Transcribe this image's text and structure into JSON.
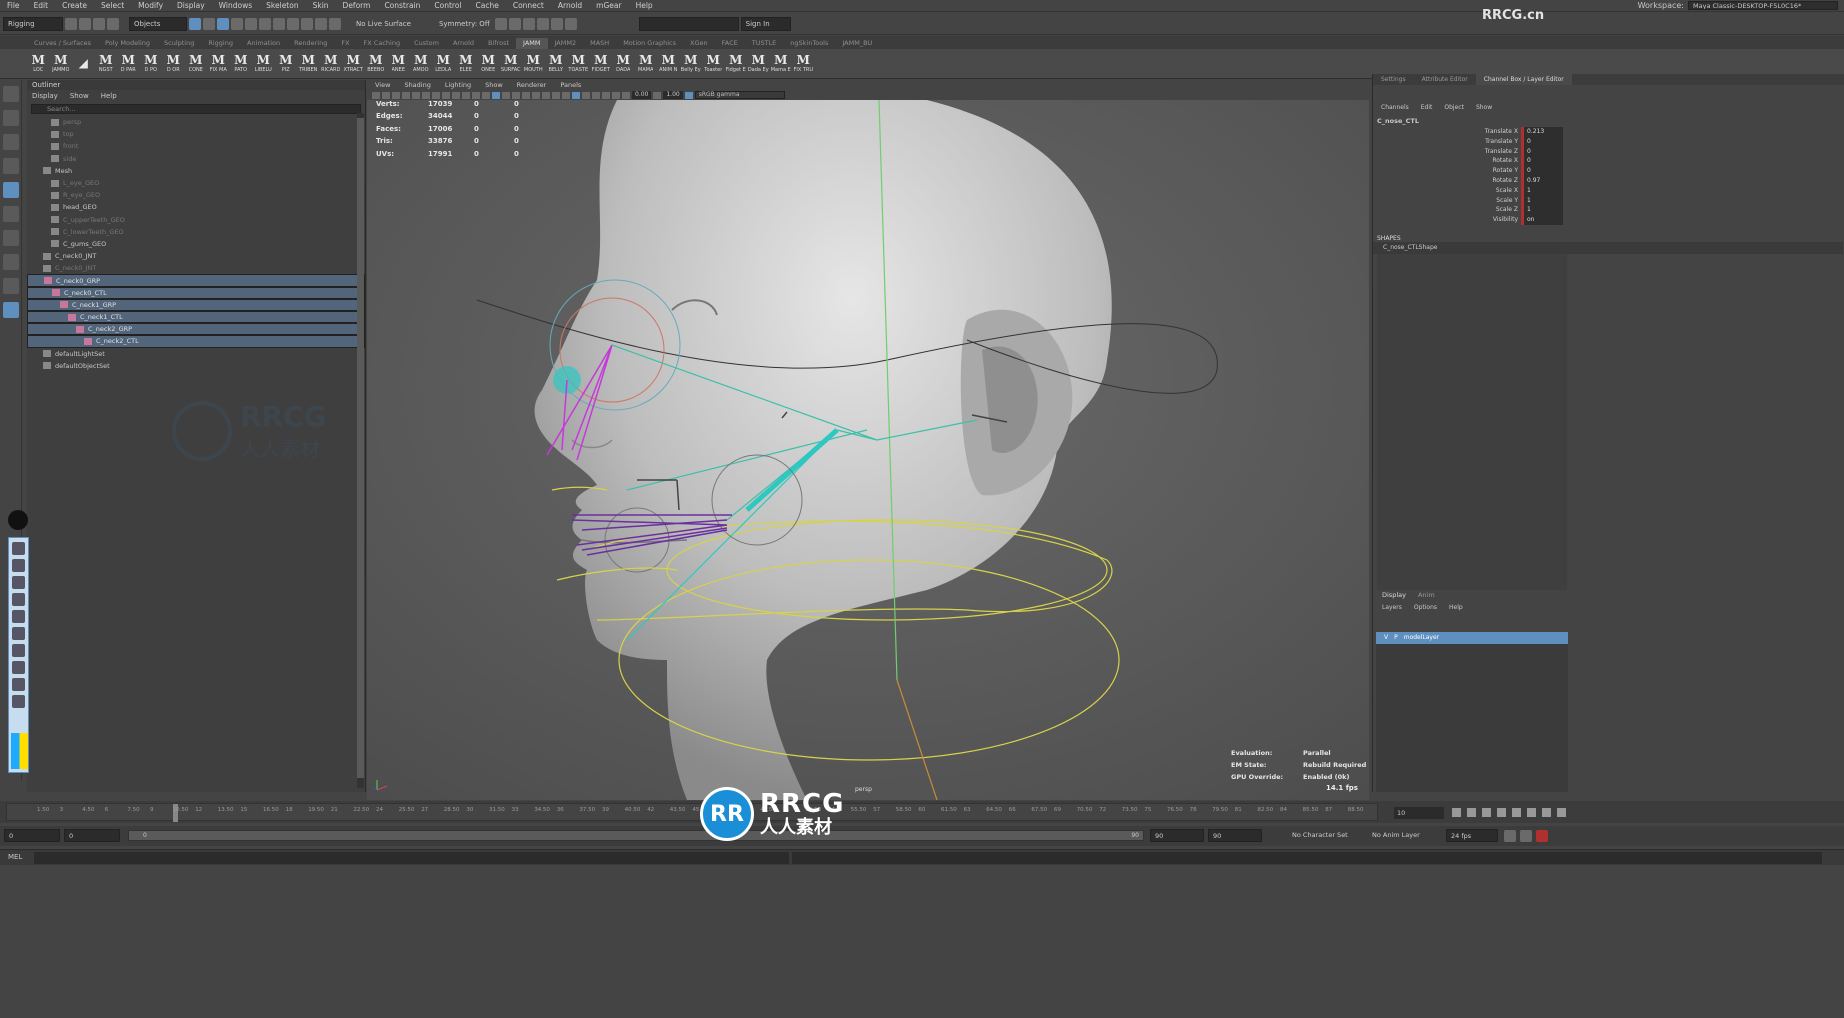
{
  "menubar": {
    "items": [
      "File",
      "Edit",
      "Create",
      "Select",
      "Modify",
      "Display",
      "Windows",
      "Skeleton",
      "Skin",
      "Deform",
      "Constrain",
      "Control",
      "Cache",
      "Connect",
      "Arnold",
      "mGear",
      "Help"
    ],
    "workspace_label": "Workspace:",
    "workspace_value": "Maya Classic-DESKTOP-F5L0C16*"
  },
  "statusline": {
    "mode": "Rigging",
    "select_mode": "Objects",
    "live_surface": "No Live Surface",
    "symmetry": "Symmetry: Off",
    "sign_in": "Sign In"
  },
  "shelf": {
    "tabs": [
      "Curves / Surfaces",
      "Poly Modeling",
      "Sculpting",
      "Rigging",
      "Animation",
      "Rendering",
      "FX",
      "FX Caching",
      "Custom",
      "Arnold",
      "Bifrost",
      "JAMM",
      "JAMM2",
      "MASH",
      "Motion Graphics",
      "XGen",
      "FACE",
      "TUSTLE",
      "ngSkinTools",
      "JAMM_BU"
    ],
    "active_tab": "JAMM",
    "buttons": [
      "LOC",
      "JAMMO",
      "",
      "NGST",
      "D PAR",
      "D PO",
      "D OR",
      "CONE",
      "FIX MA",
      "PATO",
      "LIBELU",
      "PIZ",
      "TRIBEN",
      "RICARD",
      "XTRACT",
      "BEEBO",
      "ANEE",
      "AMOO",
      "LEDLA",
      "ELEE",
      "ONEE",
      "SURFAC",
      "MOUTH",
      "BELLY",
      "TOASTE",
      "FIDGET",
      "DADA",
      "MAMA",
      "ANIM N",
      "Belly Ey",
      "Toaster",
      "Fidget E",
      "Dada Ey",
      "Mama E",
      "FIX TRU"
    ]
  },
  "outliner": {
    "title": "Outliner",
    "menu": [
      "Display",
      "Show",
      "Help"
    ],
    "search_placeholder": "Search...",
    "rows": [
      {
        "label": "persp",
        "indent": 1,
        "state": "dim"
      },
      {
        "label": "top",
        "indent": 1,
        "state": "dim"
      },
      {
        "label": "front",
        "indent": 1,
        "state": "dim"
      },
      {
        "label": "side",
        "indent": 1,
        "state": "dim"
      },
      {
        "label": "Mesh",
        "indent": 0,
        "state": "normal"
      },
      {
        "label": "L_eye_GEO",
        "indent": 1,
        "state": "dim"
      },
      {
        "label": "R_eye_GEO",
        "indent": 1,
        "state": "dim"
      },
      {
        "label": "head_GEO",
        "indent": 1,
        "state": "normal"
      },
      {
        "label": "C_upperTeeth_GEO",
        "indent": 1,
        "state": "dim"
      },
      {
        "label": "C_lowerTeeth_GEO",
        "indent": 1,
        "state": "dim"
      },
      {
        "label": "C_gums_GEO",
        "indent": 1,
        "state": "normal"
      },
      {
        "label": "C_neck0_JNT",
        "indent": 0,
        "state": "normal"
      },
      {
        "label": "C_neck0_JNT",
        "indent": 0,
        "state": "dim"
      },
      {
        "label": "C_neck0_GRP",
        "indent": 0,
        "state": "sel"
      },
      {
        "label": "C_neck0_CTL",
        "indent": 1,
        "state": "sel"
      },
      {
        "label": "C_neck1_GRP",
        "indent": 2,
        "state": "sel"
      },
      {
        "label": "C_neck1_CTL",
        "indent": 3,
        "state": "sel"
      },
      {
        "label": "C_neck2_GRP",
        "indent": 4,
        "state": "sel"
      },
      {
        "label": "C_neck2_CTL",
        "indent": 5,
        "state": "sel"
      },
      {
        "label": "defaultLightSet",
        "indent": 0,
        "state": "normal"
      },
      {
        "label": "defaultObjectSet",
        "indent": 0,
        "state": "normal"
      }
    ]
  },
  "viewport": {
    "menu": [
      "View",
      "Shading",
      "Lighting",
      "Show",
      "Renderer",
      "Panels"
    ],
    "exposure": "0.00",
    "gamma": "1.00",
    "color_mgmt": "sRGB gamma",
    "camera": "persp",
    "hud": [
      {
        "k": "Verts:",
        "v": "17039",
        "a": "0",
        "b": "0"
      },
      {
        "k": "Edges:",
        "v": "34044",
        "a": "0",
        "b": "0"
      },
      {
        "k": "Faces:",
        "v": "17006",
        "a": "0",
        "b": "0"
      },
      {
        "k": "Tris:",
        "v": "33876",
        "a": "0",
        "b": "0"
      },
      {
        "k": "UVs:",
        "v": "17991",
        "a": "0",
        "b": "0"
      }
    ],
    "eval": [
      {
        "k": "Evaluation:",
        "v": "Parallel"
      },
      {
        "k": "EM State:",
        "v": "Rebuild Required"
      },
      {
        "k": "GPU Override:",
        "v": "Enabled (0k)"
      }
    ],
    "fps": "14.1 fps"
  },
  "channelbox": {
    "tabs": [
      "Settings",
      "Attribute Editor",
      "Channel Box / Layer Editor"
    ],
    "menu": [
      "Channels",
      "Edit",
      "Object",
      "Show"
    ],
    "object": "C_nose_CTL",
    "attrs": [
      {
        "n": "Translate X",
        "v": "0.213"
      },
      {
        "n": "Translate Y",
        "v": "0"
      },
      {
        "n": "Translate Z",
        "v": "0"
      },
      {
        "n": "Rotate X",
        "v": "0"
      },
      {
        "n": "Rotate Y",
        "v": "0"
      },
      {
        "n": "Rotate Z",
        "v": "0.97"
      },
      {
        "n": "Scale X",
        "v": "1"
      },
      {
        "n": "Scale Y",
        "v": "1"
      },
      {
        "n": "Scale Z",
        "v": "1"
      },
      {
        "n": "Visibility",
        "v": "on"
      }
    ],
    "shapes_label": "SHAPES",
    "shape": "C_nose_CTLShape"
  },
  "layers": {
    "tabs": [
      "Display",
      "Anim"
    ],
    "menu": [
      "Layers",
      "Options",
      "Help"
    ],
    "layer": {
      "v": "V",
      "p": "P",
      "name": "modelLayer"
    }
  },
  "timeline": {
    "ticks": [
      "1.50",
      "3",
      "4.50",
      "6",
      "7.50",
      "9",
      "10.50",
      "12",
      "13.50",
      "15",
      "16.50",
      "18",
      "19.50",
      "21",
      "22.50",
      "24",
      "25.50",
      "27",
      "28.50",
      "30",
      "31.50",
      "33",
      "34.50",
      "36",
      "37.50",
      "39",
      "40.50",
      "42",
      "43.50",
      "45",
      "46.50",
      "48",
      "49.50",
      "51",
      "52.50",
      "54",
      "55.50",
      "57",
      "58.50",
      "60",
      "61.50",
      "63",
      "64.50",
      "66",
      "67.50",
      "69",
      "70.50",
      "72",
      "73.50",
      "75",
      "76.50",
      "78",
      "79.50",
      "81",
      "82.50",
      "84",
      "85.50",
      "87",
      "88.50"
    ],
    "current_frame": "10",
    "range_start": "0",
    "range_inner_start": "0",
    "range_slider_start": "0",
    "range_slider_end": "90",
    "range_inner_end": "90",
    "range_end": "90",
    "character_set": "No Character Set",
    "anim_layer": "No Anim Layer",
    "fps": "24 fps"
  },
  "cmdline": {
    "label": "MEL"
  },
  "watermark": {
    "logo": "RR",
    "text": "RRCG",
    "sub": "人人素材",
    "corner": "RRCG.cn"
  },
  "colors": {
    "accent": "#5f8fbf",
    "selection": "#52657a",
    "ctl_yellow": "#d7d24a",
    "ctl_teal": "#2fc8c0",
    "ctl_magenta": "#c43ad8"
  }
}
